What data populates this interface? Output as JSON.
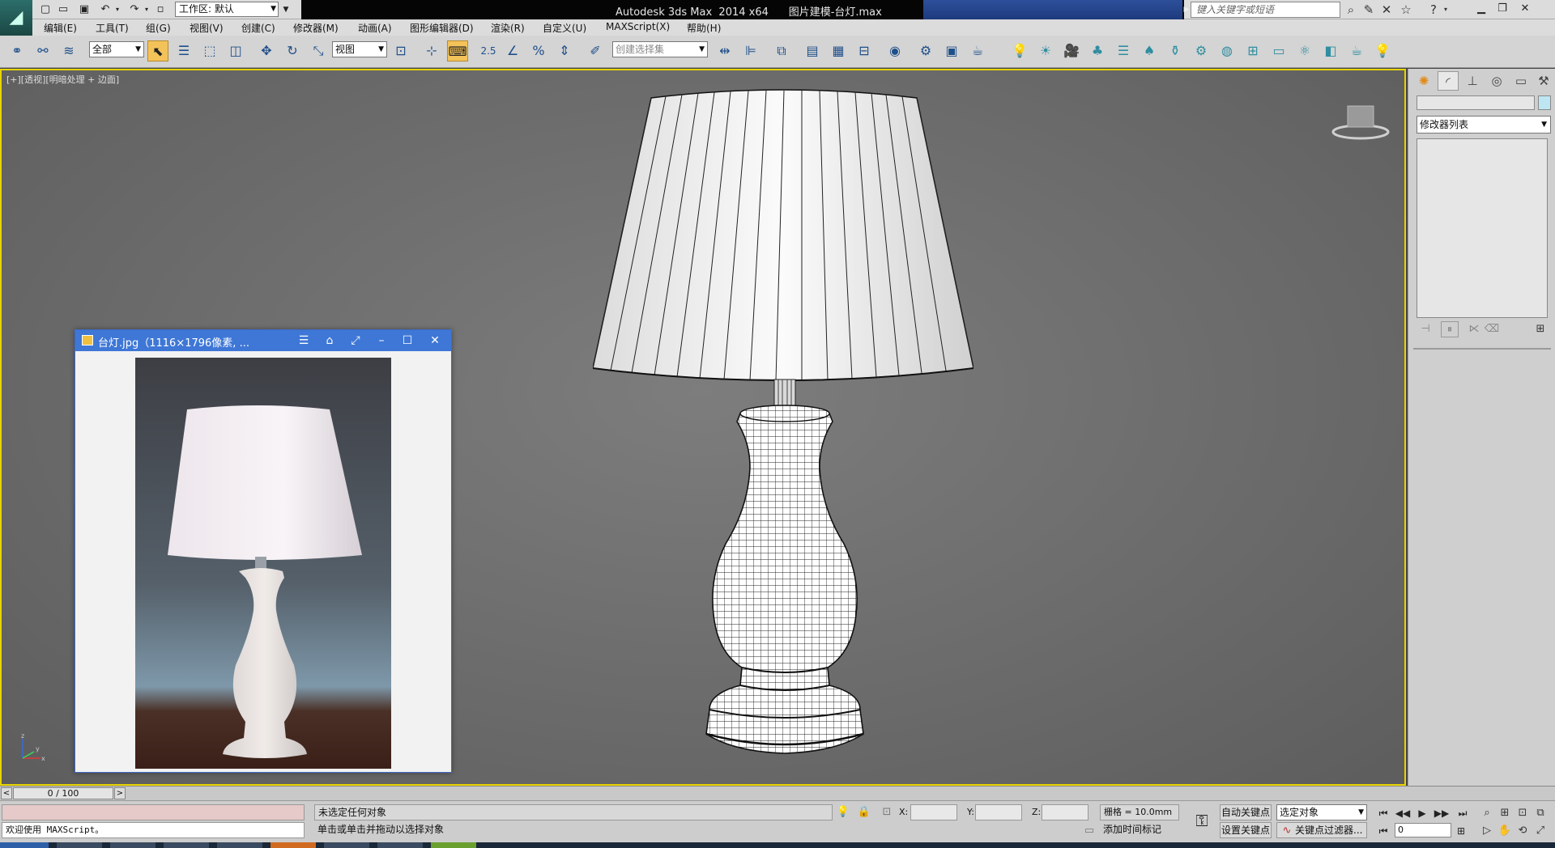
{
  "titlebar": {
    "app_title": "Autodesk 3ds Max  2014 x64",
    "file_title": "图片建模-台灯.max",
    "workspace": "工作区: 默认",
    "search_placeholder": "键入关键字或短语"
  },
  "menu": [
    {
      "id": "edit",
      "label": "编辑(E)"
    },
    {
      "id": "tools",
      "label": "工具(T)"
    },
    {
      "id": "group",
      "label": "组(G)"
    },
    {
      "id": "views",
      "label": "视图(V)"
    },
    {
      "id": "create",
      "label": "创建(C)"
    },
    {
      "id": "modifiers",
      "label": "修改器(M)"
    },
    {
      "id": "animation",
      "label": "动画(A)"
    },
    {
      "id": "graph-editors",
      "label": "图形编辑器(D)"
    },
    {
      "id": "rendering",
      "label": "渲染(R)"
    },
    {
      "id": "customize",
      "label": "自定义(U)"
    },
    {
      "id": "maxscript",
      "label": "MAXScript(X)"
    },
    {
      "id": "help",
      "label": "帮助(H)"
    }
  ],
  "toolbar": {
    "selection_filter": "全部",
    "ref_coord": "视图",
    "named_selection_placeholder": "创建选择集",
    "snap_label": "2.5"
  },
  "viewport": {
    "label": "[+][透视][明暗处理 + 边面]",
    "axis_y": "y",
    "axis_z": "z",
    "axis_x": "x"
  },
  "image_viewer": {
    "title": "台灯.jpg（1116×1796像素, ..."
  },
  "command_panel": {
    "modifier_list": "修改器列表",
    "accent_color": "#bde6f2"
  },
  "timeslider": {
    "position": "0 / 100",
    "prev": "<",
    "next": ">"
  },
  "status": {
    "maxscript_welcome": "欢迎使用 MAXScript。",
    "selection_status": "未选定任何对象",
    "prompt": "单击或单击并拖动以选择对象",
    "x_label": "X:",
    "y_label": "Y:",
    "z_label": "Z:",
    "grid": "栅格 = 10.0mm",
    "add_time_tag": "添加时间标记",
    "auto_key": "自动关键点",
    "set_key": "设置关键点",
    "selected_object": "选定对象",
    "key_filters": "关键点过滤器...",
    "current_frame": "0"
  },
  "colors": {
    "viewport_border": "#e8d400",
    "viewer_title": "#3e77d6",
    "active_tool": "#f3c35a"
  }
}
